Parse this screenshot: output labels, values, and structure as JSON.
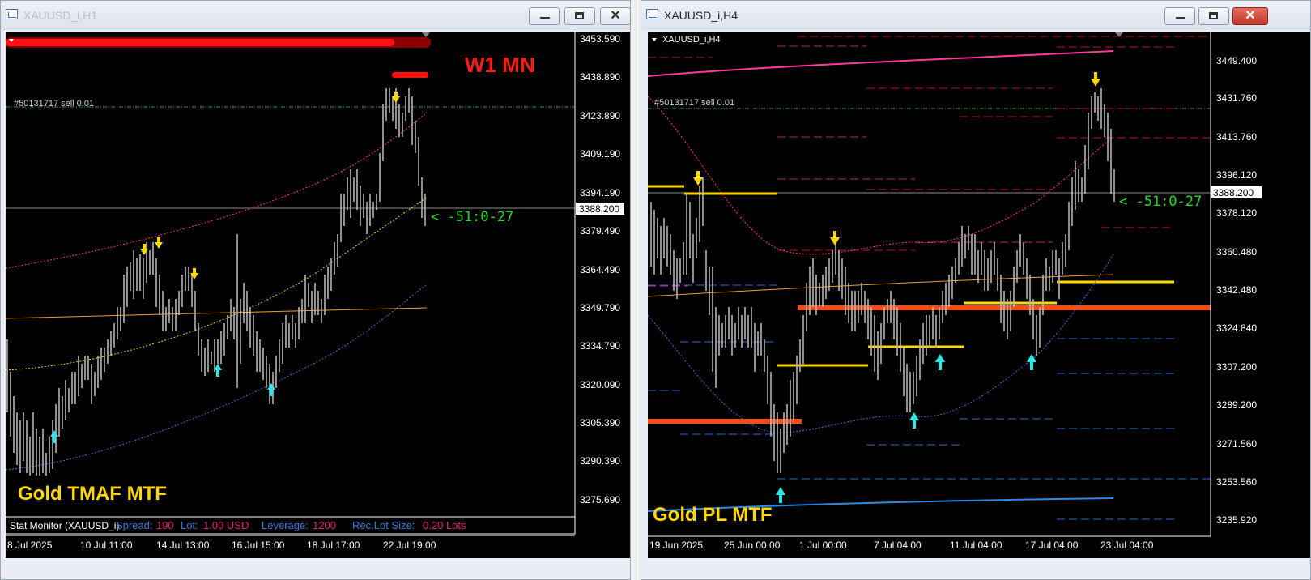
{
  "window1": {
    "title": "XAUUSD_i,H1",
    "order_label": "#50131717 sell 0.01",
    "tf_label": "W1 MN",
    "distance_label": "< -51:0-27",
    "indicator_name": "Gold TMAF MTF",
    "price_scale": [
      "3453.590",
      "3438.890",
      "3423.890",
      "3409.190",
      "3394.190",
      "3379.490",
      "3364.490",
      "3349.790",
      "3334.790",
      "3320.090",
      "3305.390",
      "3290.390",
      "3275.690"
    ],
    "current_price": "3388.200",
    "time_scale": [
      "8 Jul 2025",
      "10 Jul 11:00",
      "14 Jul 13:00",
      "16 Jul 15:00",
      "18 Jul 17:00",
      "22 Jul 19:00"
    ],
    "stat": {
      "label": "Stat Monitor (XAUUSD_i)",
      "spread_label": "Spread:",
      "spread_value": "190",
      "lot_label": "Lot:",
      "lot_value": "1.00 USD",
      "leverage_label": "Leverage:",
      "leverage_value": "1200",
      "rec_label": "Rec.Lot Size:",
      "rec_value": "0.20 Lots"
    }
  },
  "window2": {
    "title": "XAUUSD_i,H4",
    "symbol_label": "XAUUSD_i,H4",
    "order_label": "#50131717 sell 0.01",
    "distance_label": "< -51:0-27",
    "indicator_name": "Gold PL MTF",
    "price_scale": [
      "3449.400",
      "3431.760",
      "3413.760",
      "3396.120",
      "3378.120",
      "3360.480",
      "3342.480",
      "3324.840",
      "3307.200",
      "3289.200",
      "3271.560",
      "3253.560",
      "3235.920"
    ],
    "current_price": "3388.200",
    "time_scale": [
      "19 Jun 2025",
      "25 Jun 00:00",
      "1 Jul 00:00",
      "7 Jul 04:00",
      "11 Jul 04:00",
      "17 Jul 04:00",
      "23 Jul 04:00"
    ]
  },
  "colors": {
    "chart_bg": "#000000",
    "axis_text": "#ffffff",
    "yellow": "#ffd800",
    "cyan": "#2ee6e6",
    "red": "#ff1a1a",
    "green_label": "#22dd22",
    "orange_level": "#ff4a10",
    "magenta": "#e0207a"
  },
  "icons": {
    "window_icon": "chart-window-icon",
    "minimize": "minimize-icon",
    "maximize": "maximize-icon",
    "close": "close-icon",
    "sell_arrow": "arrow-down-yellow",
    "buy_arrow": "arrow-up-cyan"
  }
}
